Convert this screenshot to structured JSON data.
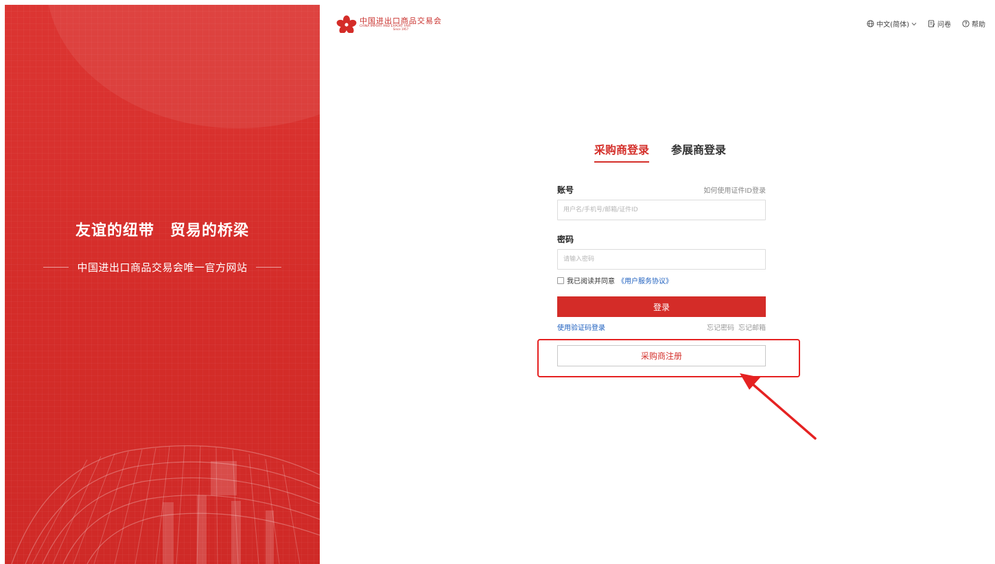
{
  "brand": {
    "logo_text_cn": "中国进出口商品交易会",
    "logo_text_en": "CHINA IMPORT AND EXPORT FAIR",
    "logo_since": "Since 1957"
  },
  "banner": {
    "slogan": "友谊的纽带　贸易的桥梁",
    "subline": "中国进出口商品交易会唯一官方网站"
  },
  "topnav": {
    "language": "中文(简体)",
    "survey": "问卷",
    "help": "帮助"
  },
  "tabs": [
    {
      "label": "采购商登录",
      "active": true
    },
    {
      "label": "参展商登录",
      "active": false
    }
  ],
  "form": {
    "account_label": "账号",
    "cert_id_link": "如何使用证件ID登录",
    "account_placeholder": "用户名/手机号/邮箱/证件ID",
    "password_label": "密码",
    "password_placeholder": "请输入密码",
    "agree_prefix": "我已阅读并同意",
    "agree_policy": "《用户服务协议》",
    "agree_checked": false,
    "login_button": "登录",
    "sms_login_link": "使用验证码登录",
    "forgot_password": "忘记密码",
    "forgot_email": "忘记邮箱",
    "register_button": "采购商注册"
  },
  "colors": {
    "brand_red": "#d42c28",
    "link_blue": "#1d5fbf",
    "annotation_red": "#e52222"
  },
  "icons": [
    "canton-fair-logo-icon",
    "globe-icon",
    "chevron-down-icon",
    "survey-icon",
    "help-circle-icon",
    "annotation-arrow"
  ]
}
